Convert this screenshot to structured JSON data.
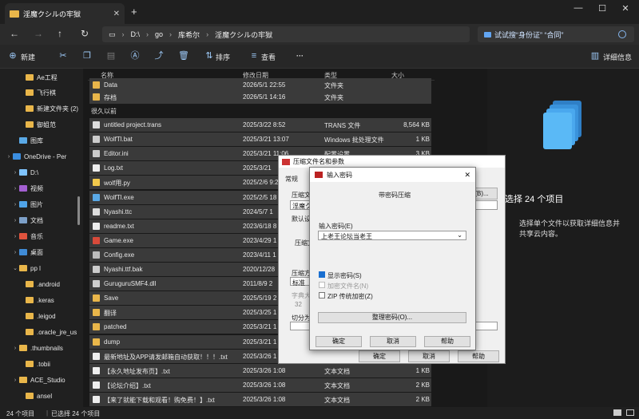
{
  "window": {
    "tab_title": "淫魔クシルの牢獄",
    "tab_close": "✕",
    "new_tab": "+",
    "minimize": "—",
    "maximize": "☐",
    "close": "✕"
  },
  "address": {
    "crumbs": [
      "D:\\",
      "go",
      "库希尔",
      "淫魔クシルの牢獄"
    ],
    "search_placeholder": "试试搜“身份证” “合同”"
  },
  "toolbar": {
    "new_label": "新建",
    "sort_label": "排序",
    "view_label": "查看",
    "more_label": "···",
    "details_label": "详细信息"
  },
  "nav": {
    "items": [
      {
        "label": "Ae工程",
        "color": "#e9b64a",
        "chev": ""
      },
      {
        "label": "飞行棋",
        "color": "#e9b64a",
        "chev": ""
      },
      {
        "label": "新建文件夹 (2)",
        "color": "#e9b64a",
        "chev": ""
      },
      {
        "label": "御姐范",
        "color": "#e9b64a",
        "chev": ""
      },
      {
        "label": "图库",
        "color": "#5aa9e6",
        "chev": ""
      },
      {
        "label": "OneDrive - Per",
        "color": "#3b8ee0",
        "chev": "›"
      },
      {
        "label": "D:\\",
        "color": "#7fc4ff",
        "chev": "›"
      },
      {
        "label": "视频",
        "color": "#a35fd1",
        "chev": "›"
      },
      {
        "label": "图片",
        "color": "#4fa3e8",
        "chev": "›"
      },
      {
        "label": "文档",
        "color": "#7da0c8",
        "chev": "›"
      },
      {
        "label": "音乐",
        "color": "#e0533d",
        "chev": "›"
      },
      {
        "label": "桌面",
        "color": "#3f8bd6",
        "chev": "›"
      },
      {
        "label": "pp l",
        "color": "#e9b64a",
        "chev": "⌄"
      },
      {
        "label": ".android",
        "color": "#e9b64a",
        "chev": ""
      },
      {
        "label": ".keras",
        "color": "#e9b64a",
        "chev": ""
      },
      {
        "label": ".leigod",
        "color": "#e9b64a",
        "chev": ""
      },
      {
        "label": ".oracle_jre_us",
        "color": "#e9b64a",
        "chev": ""
      },
      {
        "label": ".thumbnails",
        "color": "#e9b64a",
        "chev": "›"
      },
      {
        "label": ".tobii",
        "color": "#e9b64a",
        "chev": ""
      },
      {
        "label": "ACE_Studio",
        "color": "#e9b64a",
        "chev": "›"
      },
      {
        "label": "ansel",
        "color": "#e9b64a",
        "chev": ""
      }
    ]
  },
  "columns": {
    "name": "名称",
    "modified": "修改日期",
    "type": "类型",
    "size": "大小"
  },
  "group_label": "很久以前",
  "files_top": [
    {
      "name": "Data",
      "date": "2026/5/1 22:55",
      "type": "文件夹",
      "size": ""
    },
    {
      "name": "存档",
      "date": "2026/5/1 14:16",
      "type": "文件夹",
      "size": ""
    }
  ],
  "files": [
    {
      "name": "untitled project.trans",
      "date": "2025/3/22 8:52",
      "type": "TRANS 文件",
      "size": "8,564 KB",
      "color": "#dddddd"
    },
    {
      "name": "WolfTl.bat",
      "date": "2025/3/21 13:07",
      "type": "Windows 批处理文件",
      "size": "1 KB",
      "color": "#cccccc"
    },
    {
      "name": "Editor.ini",
      "date": "2025/3/21 11:06",
      "type": "配置设置",
      "size": "3 KB",
      "color": "#cccccc"
    },
    {
      "name": "Log.txt",
      "date": "2025/3/21",
      "type": "",
      "size": "",
      "color": "#eeeeee"
    },
    {
      "name": "wolf用.py",
      "date": "2025/2/6 9:2",
      "type": "",
      "size": "",
      "color": "#f2c94c"
    },
    {
      "name": "WolfTl.exe",
      "date": "2025/2/5 18",
      "type": "",
      "size": "",
      "color": "#5aa9e6"
    },
    {
      "name": "Nyashi.ttc",
      "date": "2024/5/7 1",
      "type": "",
      "size": "",
      "color": "#dddddd"
    },
    {
      "name": "readme.txt",
      "date": "2023/6/18 8",
      "type": "",
      "size": "",
      "color": "#eeeeee"
    },
    {
      "name": "Game.exe",
      "date": "2023/4/29 1",
      "type": "",
      "size": "",
      "color": "#d84a3a"
    },
    {
      "name": "Config.exe",
      "date": "2023/4/11 1",
      "type": "",
      "size": "",
      "color": "#bbbbbb"
    },
    {
      "name": "Nyashi.ttf.bak",
      "date": "2020/12/28",
      "type": "",
      "size": "",
      "color": "#cccccc"
    },
    {
      "name": "GuruguruSMF4.dll",
      "date": "2011/8/9 2",
      "type": "",
      "size": "",
      "color": "#cccccc"
    },
    {
      "name": "Save",
      "date": "2025/5/19 2",
      "type": "",
      "size": "",
      "color": "#e9b64a"
    },
    {
      "name": "翻译",
      "date": "2025/3/25 1",
      "type": "",
      "size": "",
      "color": "#e9b64a"
    },
    {
      "name": "patched",
      "date": "2025/3/21 1",
      "type": "",
      "size": "",
      "color": "#e9b64a"
    },
    {
      "name": "dump",
      "date": "2025/3/21 1",
      "type": "",
      "size": "",
      "color": "#e9b64a"
    },
    {
      "name": "最新地址及APP请发邮箱自动获取！！！.txt",
      "date": "2025/3/26 1",
      "type": "",
      "size": "",
      "color": "#eeeeee"
    },
    {
      "name": "【永久地址发布页】.txt",
      "date": "2025/3/26 1:08",
      "type": "文本文档",
      "size": "1 KB",
      "color": "#eeeeee"
    },
    {
      "name": "【论坛介绍】.txt",
      "date": "2025/3/26 1:08",
      "type": "文本文档",
      "size": "2 KB",
      "color": "#eeeeee"
    },
    {
      "name": "【来了就能下载和观看！购免费！】.txt",
      "date": "2025/3/26 1:08",
      "type": "文本文档",
      "size": "2 KB",
      "color": "#eeeeee"
    }
  ],
  "details": {
    "title": "选择 24 个项目",
    "hint": "选择单个文件以获取详细信息并共享云内容。"
  },
  "status": {
    "count": "24 个项目",
    "selected": "已选择 24 个项目"
  },
  "dialog_compress": {
    "title": "压缩文件名和参数",
    "tab_general": "常规",
    "archive_label": "压缩文件",
    "archive_value": "淫魔ク",
    "browse_label": "(B)...",
    "default_profile_label": "默认设",
    "format_label": "压缩文",
    "method_label": "压缩方",
    "method_value": "标准",
    "dict_label": "字典大",
    "dict_value": "32",
    "split_label": "切分为",
    "ok": "确定",
    "cancel": "取消",
    "help": "帮助"
  },
  "dialog_password": {
    "title": "输入密码",
    "close": "✕",
    "header": "带密码压缩",
    "pw_label": "输入密码(E)",
    "pw_value": "上老王论坛当老王",
    "show_pw": "显示密码(S)",
    "encrypt_names": "加密文件名(N)",
    "zip_legacy": "ZIP 传统加密(Z)",
    "organize": "整理密码(O)...",
    "ok": "确定",
    "cancel": "取消",
    "help": "帮助"
  }
}
